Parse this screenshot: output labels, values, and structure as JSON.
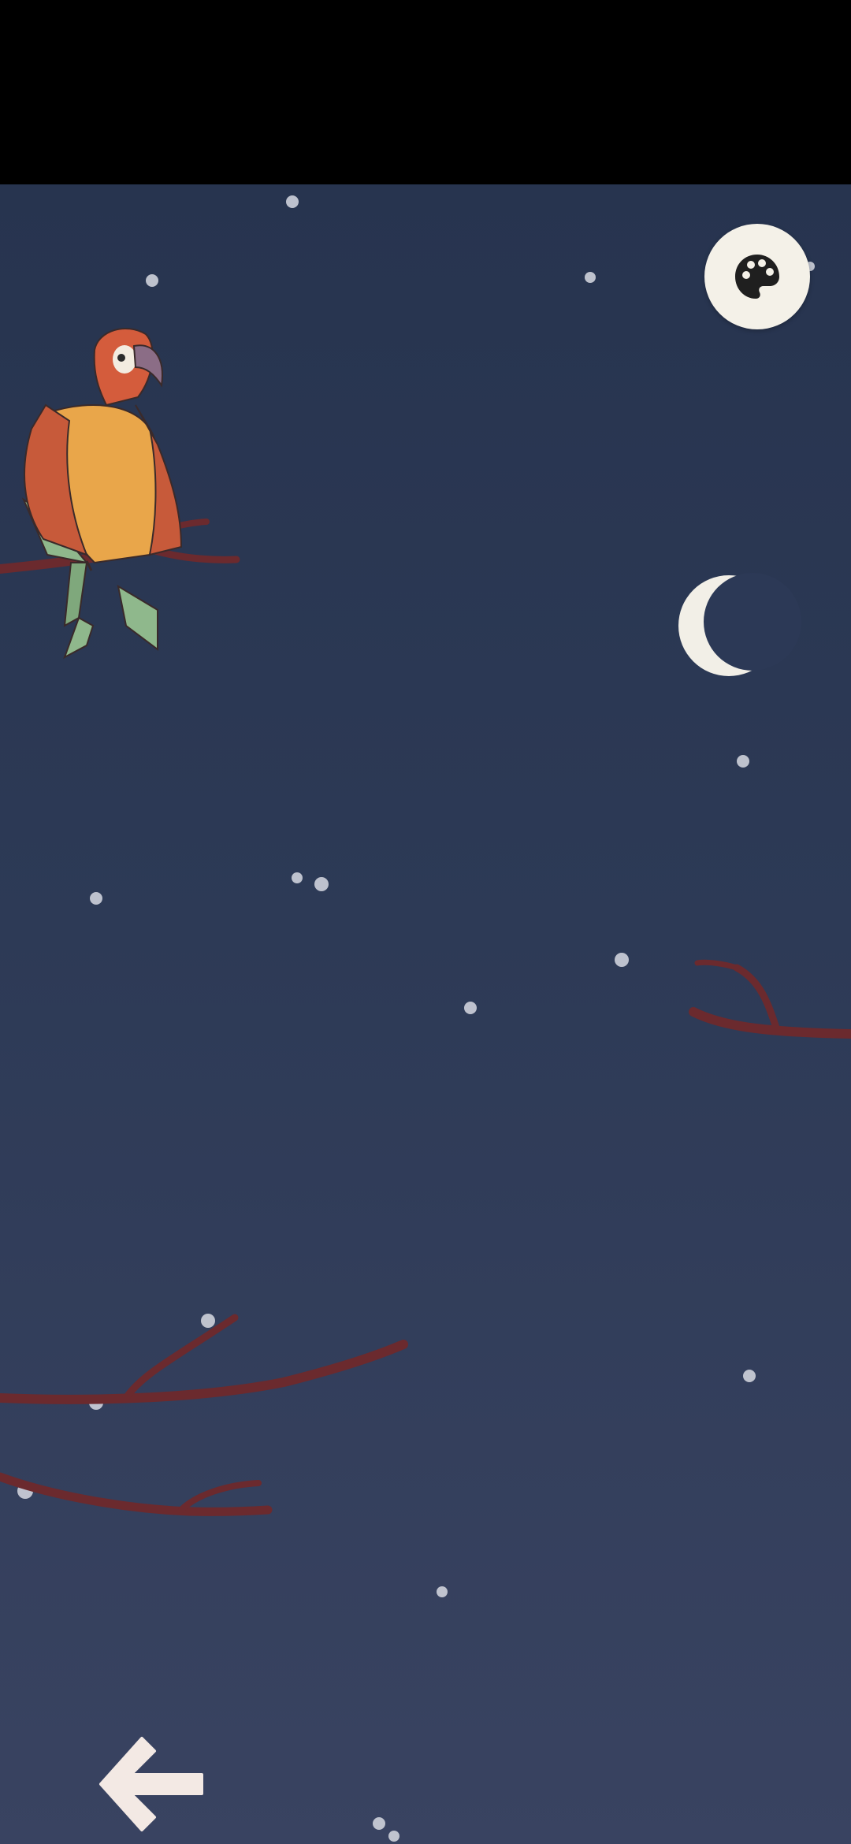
{
  "app": {
    "screen": "night-scene",
    "background_colors": [
      "#27344f",
      "#394361"
    ]
  },
  "controls": {
    "palette_button_icon": "palette-icon",
    "back_button_icon": "arrow-left-icon"
  },
  "scene": {
    "sky": "night",
    "moon_phase": "crescent",
    "bird": "macaw-parrot",
    "branch_color": "#6b2a2e",
    "snow_color": "#d8dbe3"
  }
}
